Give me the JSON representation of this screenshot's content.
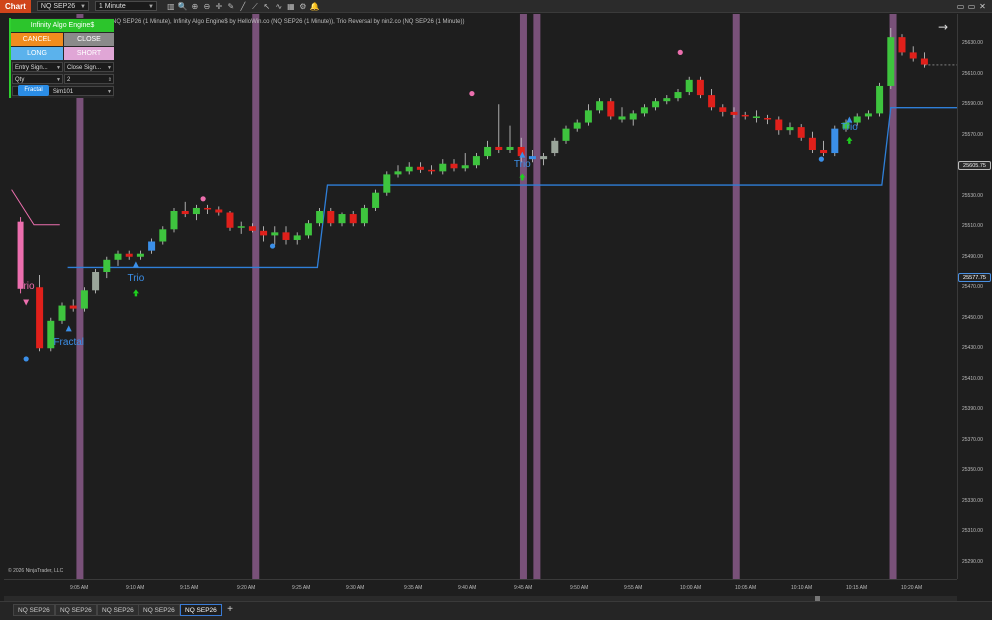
{
  "toolbar": {
    "chart_label": "Chart",
    "instrument": "NQ SEP26",
    "interval": "1 Minute",
    "tools": [
      "bar-chart-icon",
      "magnify-icon",
      "zoom-in-icon",
      "zoom-out-icon",
      "crosshair-icon",
      "pencil-icon",
      "line-draw-icon",
      "trend-icon",
      "pointer-icon",
      "wave-icon",
      "grid-icon",
      "properties-icon",
      "alert-icon"
    ],
    "tool_glyphs": [
      "▥",
      "🔍",
      "⊕",
      "⊖",
      "✛",
      "✎",
      "╱",
      "⟋",
      "↖",
      "∿",
      "▦",
      "⚙",
      "🔔"
    ]
  },
  "window_controls": [
    "▭",
    "▭",
    "✕"
  ],
  "indicator_label": "NQ SEP26 (1 Minute), Infinity Algo Engine$ by HelloWin.co (NQ SEP26 (1 Minute)), Trio Reversal by nin2.co (NQ SEP26 (1 Minute))",
  "panel": {
    "engine_label": "Infinity Algo Engine$",
    "cancel_label": "CANCEL",
    "close_label": "CLOSE",
    "long_label": "LONG",
    "short_label": "SHORT",
    "entry_mode": "Entry Sign...",
    "close_mode": "Close Sign...",
    "qty_mode": "Qty",
    "qty_value": "2",
    "account": "Sim101",
    "fractal_badge": "Fractal"
  },
  "copyright": "© 2026 NinjaTrader, LLC",
  "price_axis": {
    "labels": [
      "25630.00",
      "25610.00",
      "25590.00",
      "25570.00",
      "25550.00",
      "25530.00",
      "25510.00",
      "25490.00",
      "25470.00",
      "25450.00",
      "25430.00",
      "25410.00",
      "25390.00",
      "25370.00",
      "25350.00",
      "25330.00",
      "25310.00",
      "25290.00"
    ],
    "last_price": "25605.75",
    "stop_price": "25577.75"
  },
  "time_axis": [
    "9:05 AM",
    "9:10 AM",
    "9:15 AM",
    "9:20 AM",
    "9:25 AM",
    "9:30 AM",
    "9:35 AM",
    "9:40 AM",
    "9:45 AM",
    "9:50 AM",
    "9:55 AM",
    "10:00 AM",
    "10:05 AM",
    "10:10 AM",
    "10:15 AM",
    "10:20 AM"
  ],
  "annotations": {
    "trio": "Trio",
    "fractal": "Fractal"
  },
  "tabs": [
    "NQ SEP26",
    "NQ SEP26",
    "NQ SEP26",
    "NQ SEP26",
    "NQ SEP26"
  ],
  "active_tab": 4,
  "colors": {
    "bull": "#3ec43e",
    "bear": "#e0201b",
    "highlight_bar": "#8a5a8a",
    "stop_line": "#2f7fd8",
    "signal_pink": "#ec6fae",
    "signal_blue": "#3b8fe8",
    "signal_green": "#1ed11e"
  },
  "candles": [
    [
      3,
      25460,
      25468,
      25418,
      25420,
      "bear"
    ],
    [
      4,
      25420,
      25440,
      25418,
      25438,
      "bull"
    ],
    [
      5,
      25438,
      25450,
      25436,
      25448,
      "bull"
    ],
    [
      6,
      25448,
      25452,
      25444,
      25446,
      "bear"
    ],
    [
      7,
      25446,
      25460,
      25444,
      25458,
      "bull"
    ],
    [
      8,
      25458,
      25472,
      25456,
      25470,
      "neutral"
    ],
    [
      9,
      25470,
      25480,
      25466,
      25478,
      "bull"
    ],
    [
      10,
      25478,
      25484,
      25474,
      25482,
      "bull"
    ],
    [
      11,
      25482,
      25484,
      25478,
      25480,
      "bear"
    ],
    [
      12,
      25480,
      25484,
      25478,
      25482,
      "bull"
    ],
    [
      13,
      25484,
      25492,
      25482,
      25490,
      "blue"
    ],
    [
      14,
      25490,
      25500,
      25488,
      25498,
      "bull"
    ],
    [
      15,
      25498,
      25512,
      25496,
      25510,
      "bull"
    ],
    [
      16,
      25510,
      25516,
      25506,
      25508,
      "bear"
    ],
    [
      17,
      25508,
      25514,
      25504,
      25512,
      "bull"
    ],
    [
      18,
      25512,
      25514,
      25508,
      25511,
      "bear"
    ],
    [
      19,
      25511,
      25513,
      25507,
      25509,
      "bear"
    ],
    [
      20,
      25509,
      25510,
      25497,
      25499,
      "bear"
    ],
    [
      21,
      25499,
      25503,
      25495,
      25500,
      "bull"
    ],
    [
      22,
      25500,
      25502,
      25496,
      25497,
      "bear"
    ],
    [
      23,
      25497,
      25500,
      25490,
      25494,
      "bear"
    ],
    [
      24,
      25494,
      25500,
      25488,
      25496,
      "bull"
    ],
    [
      25,
      25496,
      25500,
      25488,
      25491,
      "bear"
    ],
    [
      26,
      25491,
      25496,
      25488,
      25494,
      "bull"
    ],
    [
      27,
      25494,
      25504,
      25492,
      25502,
      "bull"
    ],
    [
      28,
      25502,
      25512,
      25500,
      25510,
      "bull"
    ],
    [
      29,
      25510,
      25512,
      25500,
      25502,
      "bear"
    ],
    [
      30,
      25502,
      25509,
      25500,
      25508,
      "bull"
    ],
    [
      31,
      25508,
      25510,
      25500,
      25502,
      "bear"
    ],
    [
      32,
      25502,
      25514,
      25500,
      25512,
      "bull"
    ],
    [
      33,
      25512,
      25524,
      25510,
      25522,
      "bull"
    ],
    [
      34,
      25522,
      25536,
      25520,
      25534,
      "bull"
    ],
    [
      35,
      25534,
      25540,
      25532,
      25536,
      "bull"
    ],
    [
      36,
      25536,
      25542,
      25534,
      25539,
      "bull"
    ],
    [
      37,
      25539,
      25542,
      25535,
      25537,
      "bear"
    ],
    [
      38,
      25537,
      25540,
      25534,
      25536,
      "bear"
    ],
    [
      39,
      25536,
      25544,
      25534,
      25541,
      "bull"
    ],
    [
      40,
      25541,
      25544,
      25536,
      25538,
      "bear"
    ],
    [
      41,
      25538,
      25548,
      25536,
      25540,
      "bull"
    ],
    [
      42,
      25540,
      25548,
      25538,
      25546,
      "bull"
    ],
    [
      43,
      25546,
      25556,
      25544,
      25552,
      "bull"
    ],
    [
      44,
      25552,
      25580,
      25548,
      25550,
      "bear"
    ],
    [
      45,
      25550,
      25566,
      25548,
      25552,
      "bull"
    ],
    [
      46,
      25552,
      25558,
      25542,
      25546,
      "bear"
    ],
    [
      47,
      25546,
      25550,
      25542,
      25544,
      "blue"
    ],
    [
      48,
      25544,
      25548,
      25540,
      25546,
      "neutral"
    ],
    [
      49,
      25548,
      25558,
      25546,
      25556,
      "neutral"
    ],
    [
      50,
      25556,
      25566,
      25554,
      25564,
      "bull"
    ],
    [
      51,
      25564,
      25570,
      25562,
      25568,
      "bull"
    ],
    [
      52,
      25568,
      25580,
      25566,
      25576,
      "bull"
    ],
    [
      53,
      25576,
      25584,
      25574,
      25582,
      "bull"
    ],
    [
      54,
      25582,
      25584,
      25570,
      25572,
      "bear"
    ],
    [
      55,
      25572,
      25578,
      25568,
      25570,
      "bull"
    ],
    [
      56,
      25570,
      25576,
      25566,
      25574,
      "bull"
    ],
    [
      57,
      25574,
      25580,
      25572,
      25578,
      "bull"
    ],
    [
      58,
      25578,
      25584,
      25576,
      25582,
      "bull"
    ],
    [
      59,
      25582,
      25586,
      25580,
      25584,
      "bull"
    ],
    [
      60,
      25584,
      25590,
      25582,
      25588,
      "bull"
    ],
    [
      61,
      25588,
      25598,
      25586,
      25596,
      "bull"
    ],
    [
      62,
      25596,
      25598,
      25584,
      25586,
      "bear"
    ],
    [
      63,
      25586,
      25590,
      25576,
      25578,
      "bear"
    ],
    [
      64,
      25578,
      25580,
      25572,
      25575,
      "bear"
    ],
    [
      65,
      25575,
      25578,
      25571,
      25573,
      "bear"
    ],
    [
      66,
      25573,
      25575,
      25570,
      25572,
      "bear"
    ],
    [
      67,
      25572,
      25576,
      25568,
      25571,
      "bull"
    ],
    [
      68,
      25571,
      25573,
      25567,
      25570,
      "bear"
    ],
    [
      69,
      25570,
      25572,
      25560,
      25563,
      "bear"
    ],
    [
      70,
      25563,
      25568,
      25560,
      25565,
      "bull"
    ],
    [
      71,
      25565,
      25567,
      25556,
      25558,
      "bear"
    ],
    [
      72,
      25558,
      25562,
      25548,
      25550,
      "bear"
    ],
    [
      73,
      25550,
      25556,
      25546,
      25548,
      "bear"
    ],
    [
      74,
      25548,
      25566,
      25546,
      25564,
      "blue"
    ],
    [
      75,
      25564,
      25570,
      25562,
      25568,
      "bull"
    ],
    [
      76,
      25568,
      25574,
      25566,
      25572,
      "bull"
    ],
    [
      77,
      25572,
      25576,
      25570,
      25574,
      "bull"
    ],
    [
      78,
      25574,
      25594,
      25572,
      25592,
      "bull"
    ],
    [
      79,
      25592,
      25630,
      25590,
      25624,
      "bull"
    ],
    [
      80,
      25624,
      25626,
      25612,
      25614,
      "bear"
    ],
    [
      81,
      25614,
      25618,
      25608,
      25610,
      "bear"
    ],
    [
      82,
      25610,
      25614,
      25604,
      25606,
      "bear"
    ]
  ]
}
